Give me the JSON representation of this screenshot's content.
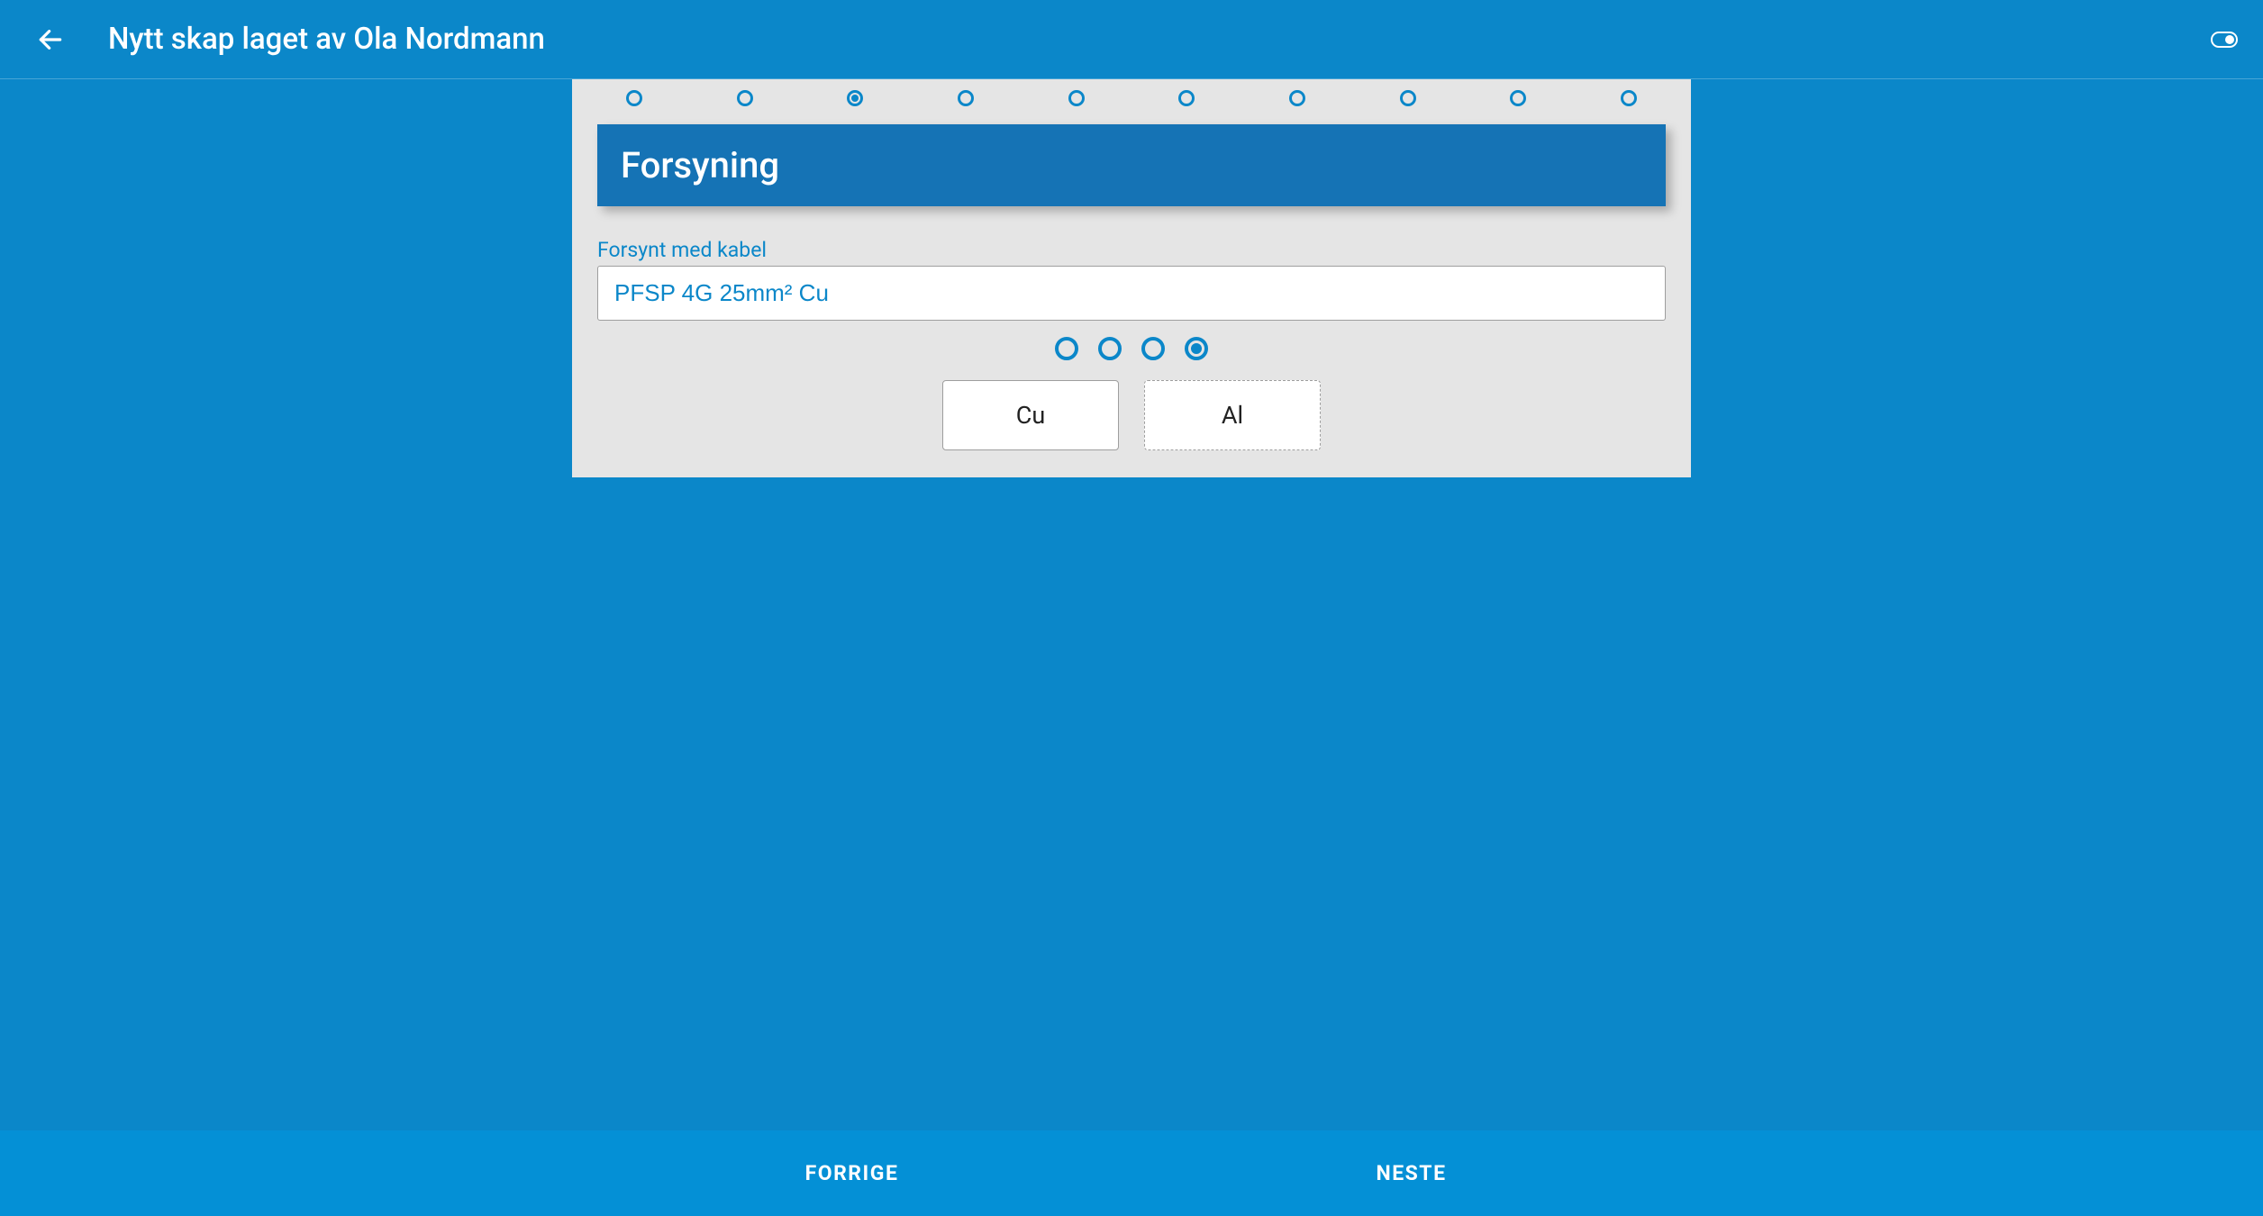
{
  "appbar": {
    "title": "Nytt skap laget av Ola Nordmann"
  },
  "stepper": {
    "steps": 10,
    "active_index": 2
  },
  "section": {
    "title": "Forsyning"
  },
  "cable_field": {
    "label": "Forsynt med kabel",
    "value": "PFSP 4G 25mm² Cu"
  },
  "inner_stepper": {
    "steps": 4,
    "active_index": 3
  },
  "materials": {
    "cu": "Cu",
    "al": "Al"
  },
  "footer": {
    "prev": "FORRIGE",
    "next": "NESTE"
  }
}
